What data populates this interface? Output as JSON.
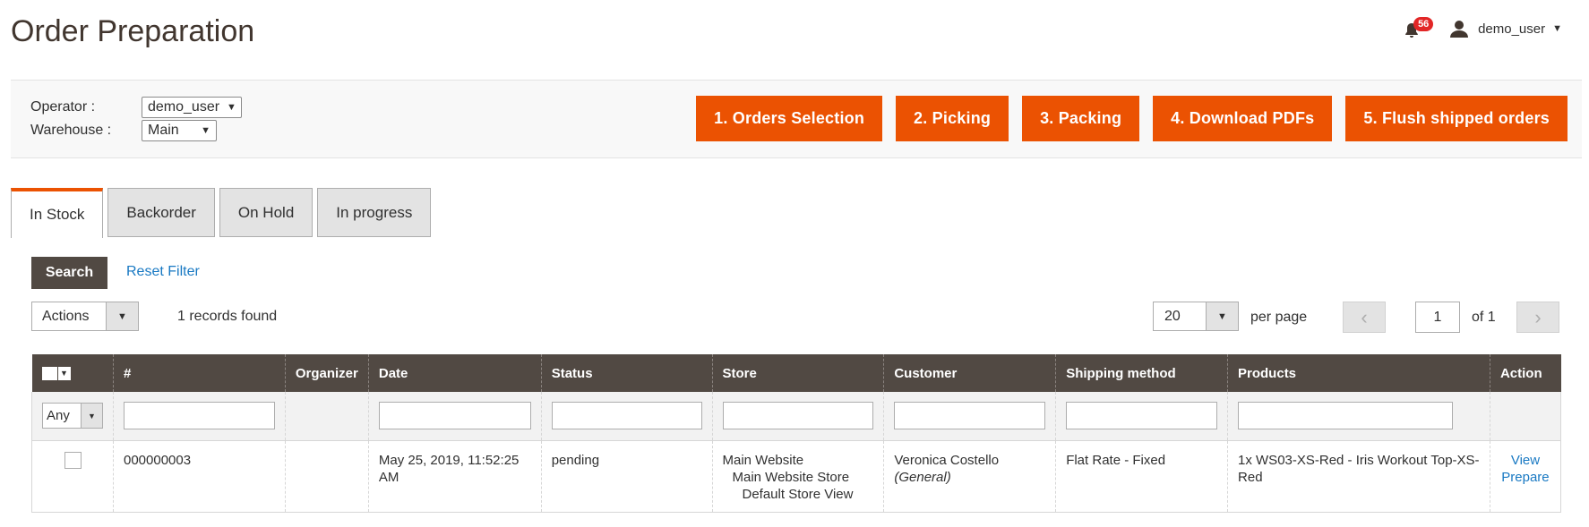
{
  "header": {
    "title": "Order Preparation",
    "notifications_count": "56",
    "user_name": "demo_user"
  },
  "toolbar": {
    "operator_label": "Operator :",
    "operator_value": "demo_user",
    "warehouse_label": "Warehouse :",
    "warehouse_value": "Main",
    "steps": [
      "1. Orders Selection",
      "2. Picking",
      "3. Packing",
      "4. Download PDFs",
      "5. Flush shipped orders"
    ],
    "accent_color": "#eb5202"
  },
  "tabs": [
    "In Stock",
    "Backorder",
    "On Hold",
    "In progress"
  ],
  "filters": {
    "search_label": "Search",
    "reset_label": "Reset Filter",
    "actions_label": "Actions",
    "records_text": "1 records found",
    "per_page_value": "20",
    "per_page_label": "per page",
    "page_current": "1",
    "page_total_text": "of 1"
  },
  "grid": {
    "columns": [
      "#",
      "Organizer",
      "Date",
      "Status",
      "Store",
      "Customer",
      "Shipping method",
      "Products",
      "Action"
    ],
    "any_label": "Any",
    "rows": [
      {
        "number": "000000003",
        "organizer": "",
        "date": "May 25, 2019, 11:52:25 AM",
        "status": "pending",
        "store_website": "Main Website",
        "store_store": "Main Website Store",
        "store_view": "Default Store View",
        "customer_name": "Veronica Costello",
        "customer_group": "(General)",
        "shipping": "Flat Rate - Fixed",
        "products": "1x WS03-XS-Red - Iris Workout Top-XS-Red",
        "action_view": "View",
        "action_prepare": "Prepare"
      }
    ]
  }
}
